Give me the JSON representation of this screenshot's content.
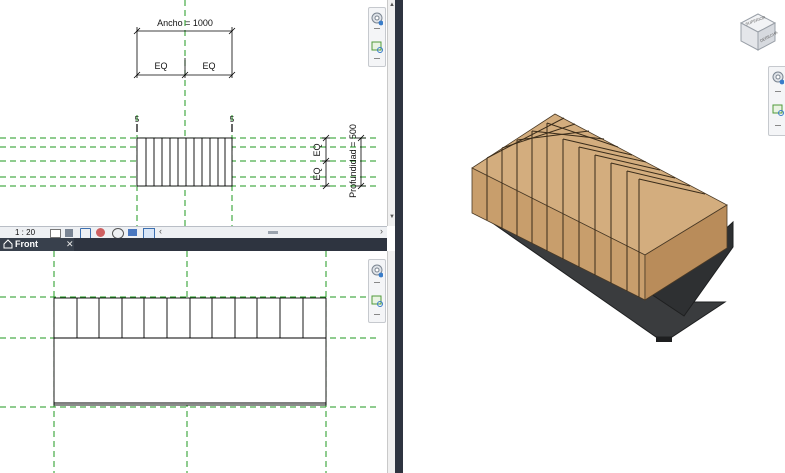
{
  "plan_view": {
    "width_dimension": "Ancho = 1000",
    "eq_left": "EQ",
    "eq_right": "EQ",
    "section_left": "5",
    "section_right": "5",
    "depth_dimension": "Profundidad = 500",
    "eq_top": "EQ",
    "eq_bottom": "EQ"
  },
  "view_control_bar": {
    "scale": "1 : 20"
  },
  "front_view": {
    "tab_label": "Front",
    "close_glyph": "✕"
  },
  "three_d_view": {
    "view_cube_faces": [
      "SUPERIOR",
      "DERECHA"
    ],
    "wood_color": "#d3ad7e",
    "metal_color": "#3a3c3e"
  },
  "colors": {
    "reference_plane": "#1f9a1f",
    "dark_chrome": "#2e3440"
  }
}
